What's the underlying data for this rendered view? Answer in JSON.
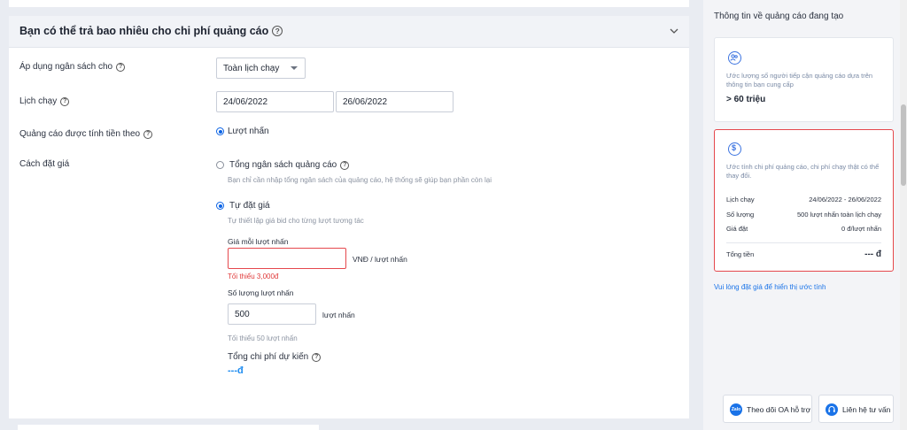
{
  "section": {
    "title": "Bạn có thể trả bao nhiêu cho chi phí quảng cáo"
  },
  "form": {
    "budget_label": "Áp dụng ngân sách cho",
    "budget_select_value": "Toàn lịch chạy",
    "schedule_label": "Lịch chạy",
    "start_date": "24/06/2022",
    "end_date": "26/06/2022",
    "billing_label": "Quảng cáo được tính tiền theo",
    "billing_option": "Lượt nhấn",
    "bid_label": "Cách đặt giá",
    "total_budget_option": "Tổng ngân sách quảng cáo",
    "total_budget_desc": "Bạn chỉ cần nhập tổng ngân sách của quảng cáo, hệ thống sẽ giúp bạn phần còn lại",
    "manual_bid_option": "Tự đặt giá",
    "manual_bid_desc": "Tự thiết lập giá bid cho từng lượt tương tác",
    "price_per_click_label": "Giá mỗi lượt nhấn",
    "price_per_click_value": "",
    "price_unit": "VNĐ / lượt nhấn",
    "price_error": "Tối thiểu 3,000đ",
    "clicks_label": "Số lượng lượt nhấn",
    "clicks_value": "500",
    "clicks_unit": "lượt nhấn",
    "clicks_hint": "Tối thiểu 50 lượt nhấn",
    "total_cost_label": "Tổng chi phí dự kiến",
    "total_cost_value": "---đ"
  },
  "panel": {
    "title": "Thông tin về quảng cáo đang tạo",
    "reach_desc": "Ước lượng số người tiếp cận quảng cáo dựa trên thông tin bạn cung cấp",
    "reach_value": "> 60 triệu",
    "cost_desc": "Ước tính chi phí quảng cáo, chi phí chạy thật có thể thay đổi.",
    "rows": [
      {
        "key": "Lịch chạy",
        "value": "24/06/2022 - 26/06/2022"
      },
      {
        "key": "Số lượng",
        "value": "500 lượt nhấn toàn lịch chạy"
      },
      {
        "key": "Giá đặt",
        "value": "0 đ/lượt nhấn"
      }
    ],
    "total_key": "Tổng tiền",
    "total_value": "--- đ",
    "hint_link": "Vui lòng đặt giá để hiển thị ước tính",
    "follow_oa_button": "Theo dõi OA hỗ trợ",
    "contact_button": "Liên hệ tư vấn",
    "zalo_badge": "Zalo"
  },
  "colors": {
    "primary": "#0b63e5",
    "error": "#e5484d",
    "accent_link": "#1a73e8"
  }
}
